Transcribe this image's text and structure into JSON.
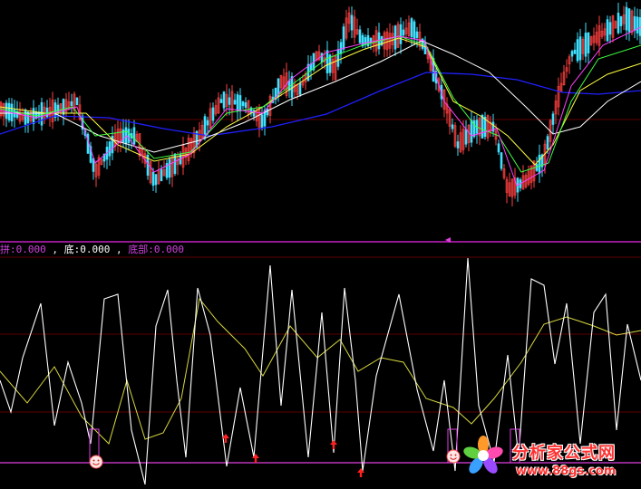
{
  "legend": {
    "items": [
      {
        "label": "拼",
        "value": "0.000",
        "color": "#d040e0"
      },
      {
        "label": "底",
        "value": "0.000",
        "color": "#ffffff"
      },
      {
        "label": "底部",
        "value": "0.000",
        "color": "#d040e0"
      }
    ]
  },
  "colors": {
    "background": "#000000",
    "rising_candle": "#ff4040",
    "falling_candle": "#40e0ff",
    "ma_white": "#ffffff",
    "ma_yellow": "#ffff40",
    "ma_green": "#40ff40",
    "ma_magenta": "#ff40ff",
    "ma_blue": "#2020ff",
    "oscillator_white": "#ffffff",
    "oscillator_yellow": "#d8d840",
    "baseline_magenta": "#e040e0",
    "grid_red": "#800000"
  },
  "icons": {
    "smiley": "smiley-face-icon",
    "arrow": "red-up-arrow-icon",
    "logo": "flower-logo-icon"
  },
  "watermark": {
    "title": "分析家公式网",
    "url": "www.88gs.com"
  }
}
